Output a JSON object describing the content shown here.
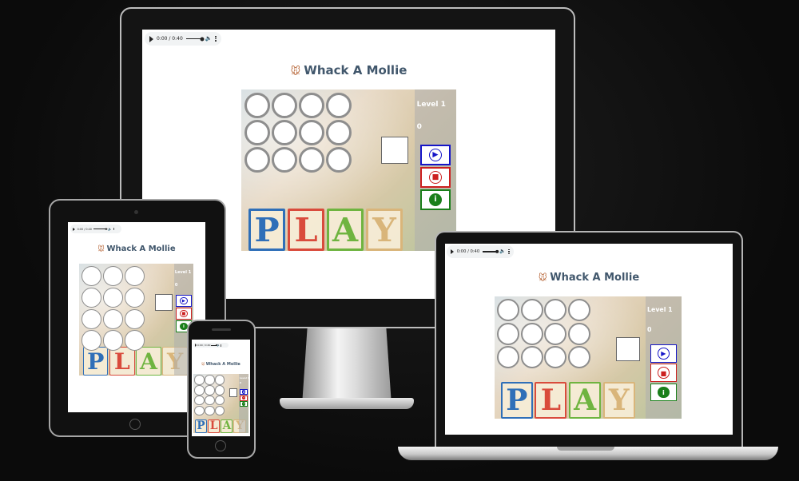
{
  "game": {
    "title": "Whack A Mollie",
    "title_icon": "mole-icon",
    "level_text": "Level 1",
    "score_text": "0",
    "hole_rows": 3,
    "hole_cols": 4,
    "board_blocks": [
      "P",
      "L",
      "A",
      "Y"
    ],
    "controls": [
      {
        "name": "play-button",
        "icon": "play-circle-icon",
        "color": "#1515c8"
      },
      {
        "name": "stop-button",
        "icon": "stop-circle-icon",
        "color": "#cc1f1f"
      },
      {
        "name": "info-button",
        "icon": "info-circle-icon",
        "color": "#1a7f1a"
      }
    ]
  },
  "audio": {
    "time_text": "0:00 / 0:40",
    "icons": [
      "play-icon",
      "volume-icon",
      "more-options-icon"
    ]
  },
  "devices": [
    "desktop-monitor",
    "tablet",
    "phone",
    "laptop"
  ],
  "colors": {
    "background": "#0b0b0b",
    "title": "#41576c",
    "block_p": "#2f6fb8",
    "block_l": "#d94b3c",
    "block_a": "#6fb440",
    "block_y": "#d9b57a",
    "hole_border": "#8e8e8e"
  }
}
